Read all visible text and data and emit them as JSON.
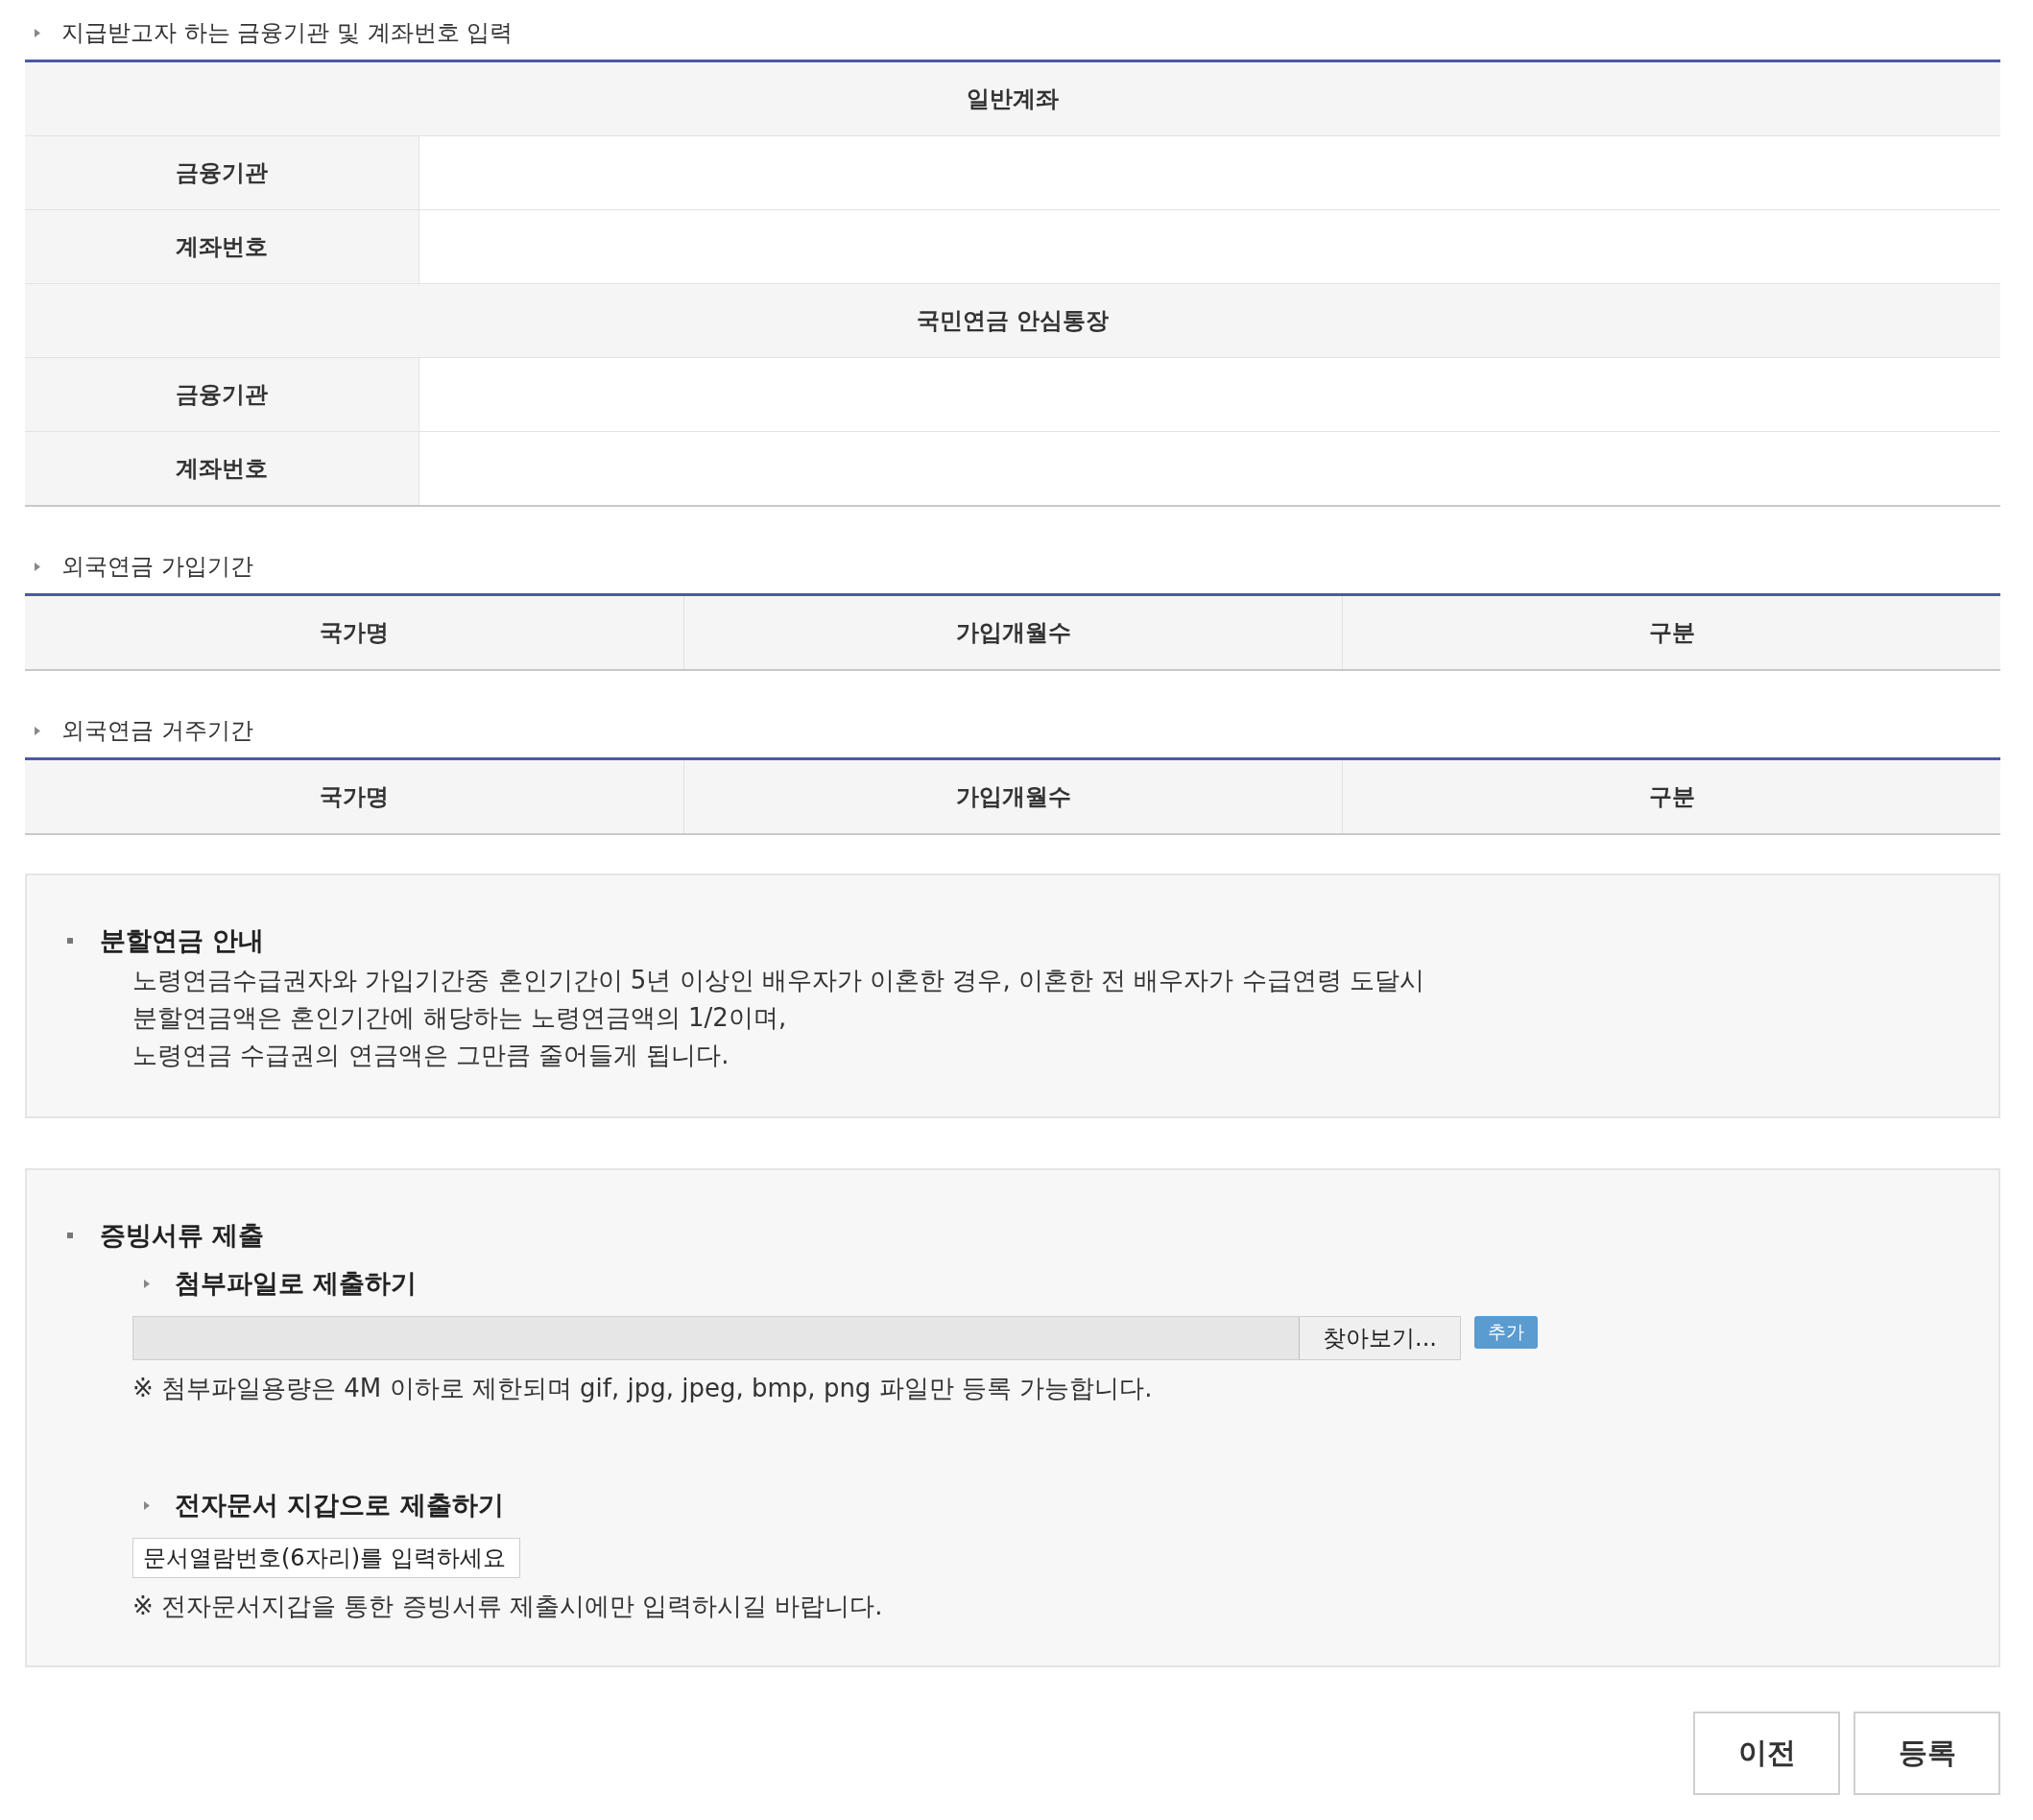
{
  "account_section": {
    "title": "지급받고자 하는 금융기관 및 계좌번호 입력",
    "groups": [
      {
        "header": "일반계좌",
        "rows": [
          {
            "label": "금융기관"
          },
          {
            "label": "계좌번호"
          }
        ]
      },
      {
        "header": "국민연금 안심통장",
        "rows": [
          {
            "label": "금융기관"
          },
          {
            "label": "계좌번호"
          }
        ]
      }
    ]
  },
  "foreign_tables": [
    {
      "title": "외국연금 가입기간",
      "columns": [
        "국가명",
        "가입개월수",
        "구분"
      ]
    },
    {
      "title": "외국연금 거주기간",
      "columns": [
        "국가명",
        "가입개월수",
        "구분"
      ]
    }
  ],
  "notice": {
    "title": "분할연금 안내",
    "lines": [
      "노령연금수급권자와 가입기간중 혼인기간이 5년 이상인 배우자가 이혼한 경우, 이혼한 전 배우자가 수급연령 도달시",
      "분할연금액은 혼인기간에 해당하는 노령연금액의 1/2이며,",
      "노령연금 수급권의 연금액은 그만큼 줄어들게 됩니다."
    ]
  },
  "evidence": {
    "title": "증빙서류 제출",
    "attach": {
      "title": "첨부파일로 제출하기",
      "browse_button": "찾아보기...",
      "add_button": "추가",
      "note": "※ 첨부파일용량은 4M 이하로 제한되며 gif, jpg, jpeg, bmp, png 파일만 등록 가능합니다."
    },
    "wallet": {
      "title": "전자문서 지갑으로 제출하기",
      "placeholder": "문서열람번호(6자리)를 입력하세요",
      "note": "※ 전자문서지갑을 통한 증빙서류 제출시에만 입력하시길 바랍니다."
    }
  },
  "buttons": [
    "이전",
    "등록"
  ]
}
